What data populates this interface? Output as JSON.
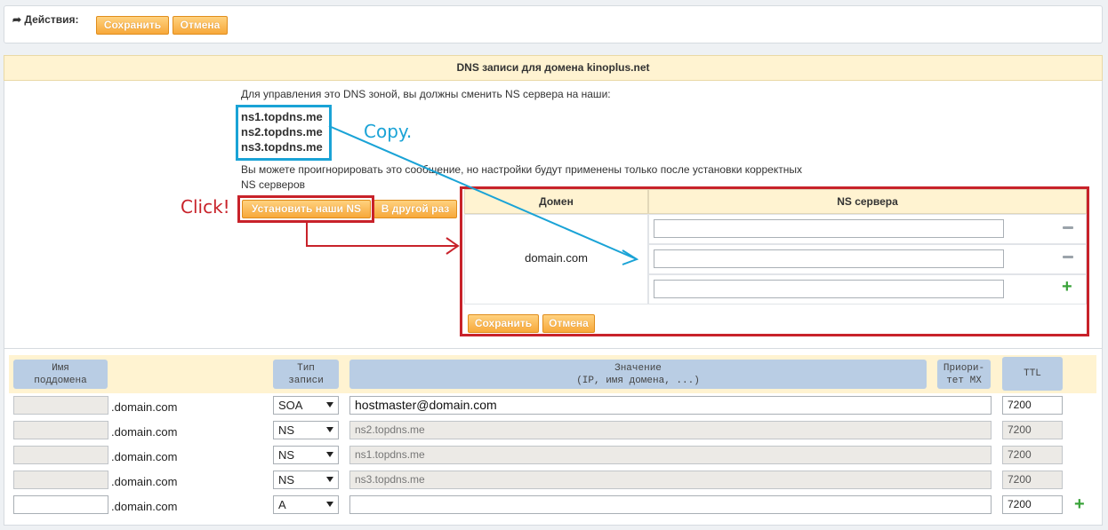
{
  "actions": {
    "label": "Действия:",
    "save": "Сохранить",
    "cancel": "Отмена"
  },
  "panel": {
    "title": "DNS записи для домена kinoplus.net",
    "info": "Для управления это DNS зоной, вы должны сменить NS сервера на наши:",
    "nameservers": [
      "ns1.topdns.me",
      "ns2.topdns.me",
      "ns3.topdns.me"
    ],
    "warning_line1": "Вы можете проигнорировать это сообщение, но настройки будут применены только после установки корректных",
    "warning_line2": "NS серверов",
    "set_ns_button": "Установить наши NS",
    "later_button": "В другой раз"
  },
  "annotations": {
    "copy": "Copy.",
    "click": "Click!",
    "colors": {
      "blue": "#1aa3d6",
      "red": "#c8222a"
    }
  },
  "ns_table": {
    "col_domain": "Домен",
    "col_ns": "NS сервера",
    "domain": "domain.com",
    "save": "Сохранить",
    "cancel": "Отмена",
    "rows": [
      {
        "value": "",
        "action": "minus-icon"
      },
      {
        "value": "",
        "action": "minus-icon"
      },
      {
        "value": "",
        "action": "plus-icon"
      }
    ]
  },
  "records": {
    "headers": {
      "name_l1": "Имя",
      "name_l2": "поддомена",
      "type_l1": "Тип",
      "type_l2": "записи",
      "value_l1": "Значение",
      "value_l2": "(IP, имя домена, ...)",
      "prio_l1": "Приори-",
      "prio_l2": "тет MX",
      "ttl": "TTL"
    },
    "rows": [
      {
        "suffix": ".domain.com",
        "type": "SOA",
        "value": "hostmaster@domain.com",
        "ttl": "7200"
      },
      {
        "suffix": ".domain.com",
        "type": "NS",
        "value": "ns2.topdns.me",
        "ttl": "7200"
      },
      {
        "suffix": ".domain.com",
        "type": "NS",
        "value": "ns1.topdns.me",
        "ttl": "7200"
      },
      {
        "suffix": ".domain.com",
        "type": "NS",
        "value": "ns3.topdns.me",
        "ttl": "7200"
      },
      {
        "suffix": ".domain.com",
        "type": "A",
        "value": "",
        "ttl": "7200"
      }
    ]
  }
}
